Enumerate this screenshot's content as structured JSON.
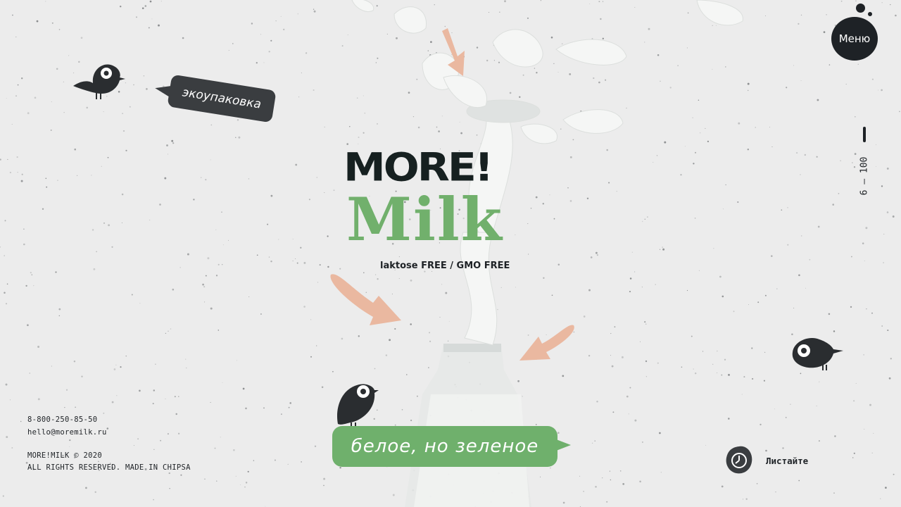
{
  "header": {
    "menu_label": "Меню",
    "age_range": "6 — 100"
  },
  "logo": {
    "line1": "MORE!",
    "line2": "Milk",
    "tagline": "laktose FREE / GMO FREE"
  },
  "badges": {
    "eco": "экоупаковка",
    "slogan": "белое, но зеленое"
  },
  "footer": {
    "phone": "8-800-250-85-50",
    "email": "hello@moremilk.ru",
    "copyright": "MORE!MILK © 2020",
    "rights": "ALL RIGHTS RESERVED. MADE IN CHIPSA"
  },
  "scroll": {
    "label": "Листайте"
  },
  "colors": {
    "background": "#ececec",
    "dark": "#1e2226",
    "green": "#71b06c",
    "arrow": "#eab8a0"
  }
}
